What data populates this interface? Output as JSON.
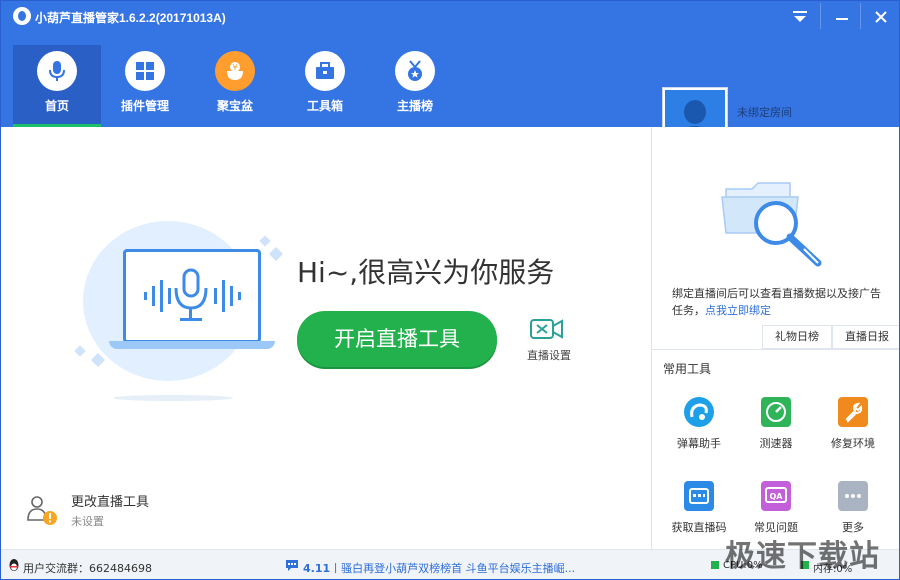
{
  "app": {
    "title": "小葫芦直播管家1.6.2.2(20171013A)",
    "window_controls": {
      "menu": "menu",
      "minimize": "minimize",
      "close": "close"
    }
  },
  "nav": {
    "items": [
      {
        "label": "首页",
        "icon": "microphone-icon",
        "active": true
      },
      {
        "label": "插件管理",
        "icon": "plugin-icon",
        "active": false
      },
      {
        "label": "聚宝盆",
        "icon": "treasure-bowl-icon",
        "active": false
      },
      {
        "label": "工具箱",
        "icon": "toolbox-icon",
        "active": false
      },
      {
        "label": "主播榜",
        "icon": "medal-icon",
        "active": false
      }
    ]
  },
  "account": {
    "status": "未绑定房间"
  },
  "hero": {
    "greeting": "Hi~,很高兴为你服务",
    "start_button": "开启直播工具",
    "live_settings": "直播设置"
  },
  "change_tool": {
    "title": "更改直播工具",
    "subtitle": "未设置"
  },
  "right_panel": {
    "description": "绑定直播间后可以查看直播数据以及接广告任务，",
    "bind_link": "点我立即绑定",
    "tabs": [
      "礼物日榜",
      "直播日报"
    ],
    "common_tools_title": "常用工具",
    "tools": [
      {
        "label": "弹幕助手",
        "icon": "danmaku-icon",
        "color": "#1ea0e8"
      },
      {
        "label": "测速器",
        "icon": "speedometer-icon",
        "color": "#2fb45a"
      },
      {
        "label": "修复环境",
        "icon": "repair-icon",
        "color": "#f08a1c"
      },
      {
        "label": "获取直播码",
        "icon": "stream-code-icon",
        "color": "#2a8ae6"
      },
      {
        "label": "常见问题",
        "icon": "qa-icon",
        "color": "#c35fd8"
      },
      {
        "label": "更多",
        "icon": "more-icon",
        "color": "#a9b3c2"
      }
    ]
  },
  "status_bar": {
    "qq_group": "用户交流群：662484698",
    "news_version": "4.11",
    "news_text": "丨骚白再登小葫芦双榜榜首 斗鱼平台娱乐主播崛...",
    "cpu": "CPU:0%",
    "memory": "内存:0%"
  },
  "watermark": "极速下载站",
  "colors": {
    "brand_blue": "#3574e3",
    "nav_active": "#2a5fc6",
    "start_green": "#22b14c",
    "link_blue": "#2e6fd8"
  }
}
